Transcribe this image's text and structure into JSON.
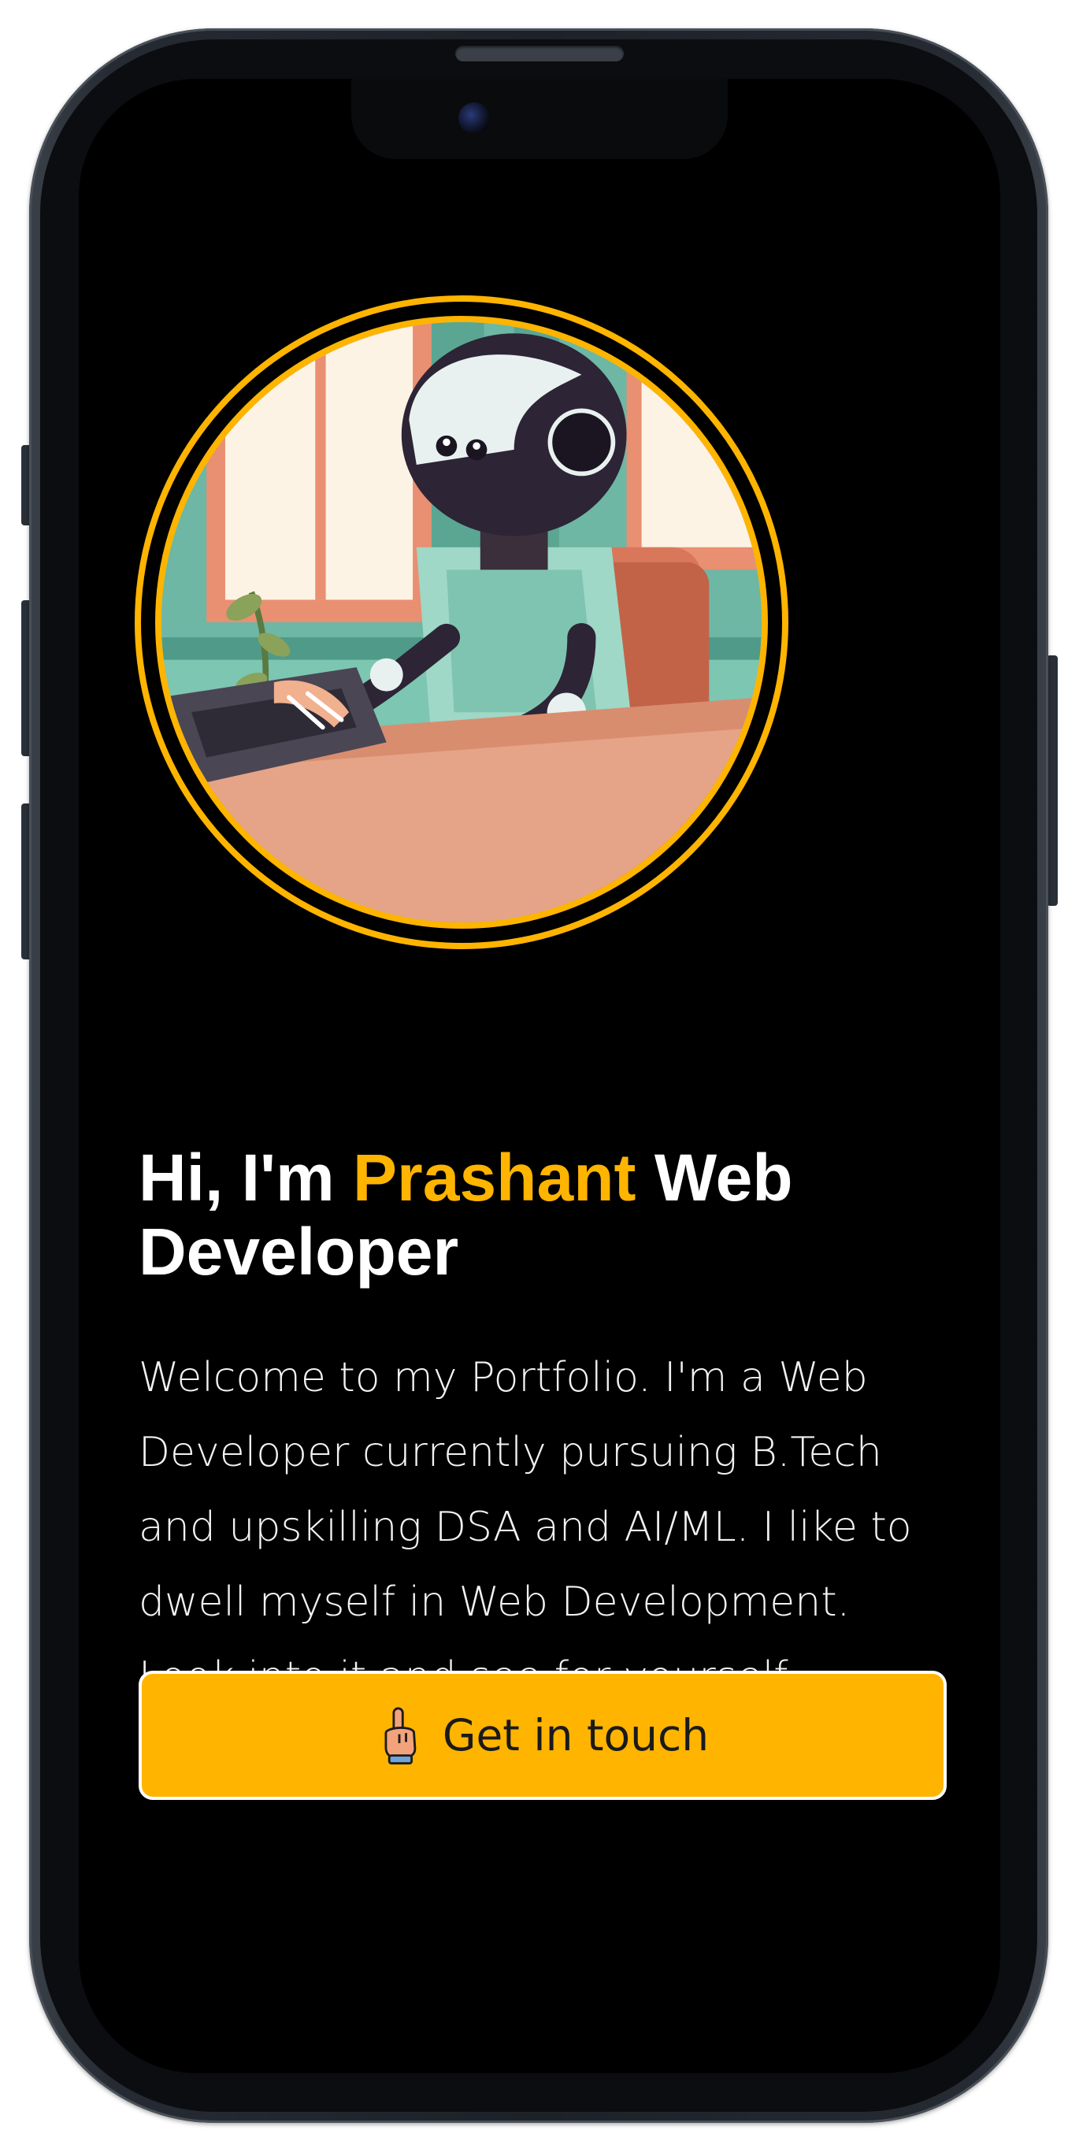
{
  "hero": {
    "greeting_prefix": "Hi, I'm ",
    "name": "Prashant",
    "greeting_suffix": " Web Developer",
    "intro": "Welcome to my Portfolio. I'm a Web Developer currently pursuing B.Tech and upskilling DSA and AI/ML. I like to dwell myself in Web Development. Look into it and see for yourself.",
    "avatar_icon": "robot-at-laptop-illustration",
    "cta": {
      "label": "Get in touch",
      "icon": "pointing-hand-icon"
    }
  },
  "colors": {
    "accent": "#ffb400",
    "background": "#000000",
    "text": "#ffffff"
  }
}
